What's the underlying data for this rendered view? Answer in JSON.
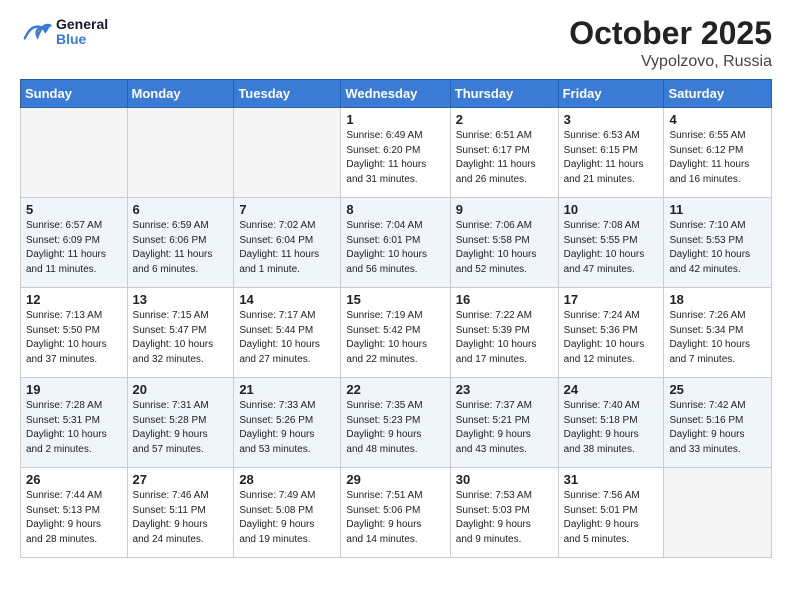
{
  "header": {
    "logo_line1": "General",
    "logo_line2": "Blue",
    "month": "October 2025",
    "location": "Vypolzovo, Russia"
  },
  "weekdays": [
    "Sunday",
    "Monday",
    "Tuesday",
    "Wednesday",
    "Thursday",
    "Friday",
    "Saturday"
  ],
  "weeks": [
    [
      {
        "day": "",
        "info": ""
      },
      {
        "day": "",
        "info": ""
      },
      {
        "day": "",
        "info": ""
      },
      {
        "day": "1",
        "info": "Sunrise: 6:49 AM\nSunset: 6:20 PM\nDaylight: 11 hours\nand 31 minutes."
      },
      {
        "day": "2",
        "info": "Sunrise: 6:51 AM\nSunset: 6:17 PM\nDaylight: 11 hours\nand 26 minutes."
      },
      {
        "day": "3",
        "info": "Sunrise: 6:53 AM\nSunset: 6:15 PM\nDaylight: 11 hours\nand 21 minutes."
      },
      {
        "day": "4",
        "info": "Sunrise: 6:55 AM\nSunset: 6:12 PM\nDaylight: 11 hours\nand 16 minutes."
      }
    ],
    [
      {
        "day": "5",
        "info": "Sunrise: 6:57 AM\nSunset: 6:09 PM\nDaylight: 11 hours\nand 11 minutes."
      },
      {
        "day": "6",
        "info": "Sunrise: 6:59 AM\nSunset: 6:06 PM\nDaylight: 11 hours\nand 6 minutes."
      },
      {
        "day": "7",
        "info": "Sunrise: 7:02 AM\nSunset: 6:04 PM\nDaylight: 11 hours\nand 1 minute."
      },
      {
        "day": "8",
        "info": "Sunrise: 7:04 AM\nSunset: 6:01 PM\nDaylight: 10 hours\nand 56 minutes."
      },
      {
        "day": "9",
        "info": "Sunrise: 7:06 AM\nSunset: 5:58 PM\nDaylight: 10 hours\nand 52 minutes."
      },
      {
        "day": "10",
        "info": "Sunrise: 7:08 AM\nSunset: 5:55 PM\nDaylight: 10 hours\nand 47 minutes."
      },
      {
        "day": "11",
        "info": "Sunrise: 7:10 AM\nSunset: 5:53 PM\nDaylight: 10 hours\nand 42 minutes."
      }
    ],
    [
      {
        "day": "12",
        "info": "Sunrise: 7:13 AM\nSunset: 5:50 PM\nDaylight: 10 hours\nand 37 minutes."
      },
      {
        "day": "13",
        "info": "Sunrise: 7:15 AM\nSunset: 5:47 PM\nDaylight: 10 hours\nand 32 minutes."
      },
      {
        "day": "14",
        "info": "Sunrise: 7:17 AM\nSunset: 5:44 PM\nDaylight: 10 hours\nand 27 minutes."
      },
      {
        "day": "15",
        "info": "Sunrise: 7:19 AM\nSunset: 5:42 PM\nDaylight: 10 hours\nand 22 minutes."
      },
      {
        "day": "16",
        "info": "Sunrise: 7:22 AM\nSunset: 5:39 PM\nDaylight: 10 hours\nand 17 minutes."
      },
      {
        "day": "17",
        "info": "Sunrise: 7:24 AM\nSunset: 5:36 PM\nDaylight: 10 hours\nand 12 minutes."
      },
      {
        "day": "18",
        "info": "Sunrise: 7:26 AM\nSunset: 5:34 PM\nDaylight: 10 hours\nand 7 minutes."
      }
    ],
    [
      {
        "day": "19",
        "info": "Sunrise: 7:28 AM\nSunset: 5:31 PM\nDaylight: 10 hours\nand 2 minutes."
      },
      {
        "day": "20",
        "info": "Sunrise: 7:31 AM\nSunset: 5:28 PM\nDaylight: 9 hours\nand 57 minutes."
      },
      {
        "day": "21",
        "info": "Sunrise: 7:33 AM\nSunset: 5:26 PM\nDaylight: 9 hours\nand 53 minutes."
      },
      {
        "day": "22",
        "info": "Sunrise: 7:35 AM\nSunset: 5:23 PM\nDaylight: 9 hours\nand 48 minutes."
      },
      {
        "day": "23",
        "info": "Sunrise: 7:37 AM\nSunset: 5:21 PM\nDaylight: 9 hours\nand 43 minutes."
      },
      {
        "day": "24",
        "info": "Sunrise: 7:40 AM\nSunset: 5:18 PM\nDaylight: 9 hours\nand 38 minutes."
      },
      {
        "day": "25",
        "info": "Sunrise: 7:42 AM\nSunset: 5:16 PM\nDaylight: 9 hours\nand 33 minutes."
      }
    ],
    [
      {
        "day": "26",
        "info": "Sunrise: 7:44 AM\nSunset: 5:13 PM\nDaylight: 9 hours\nand 28 minutes."
      },
      {
        "day": "27",
        "info": "Sunrise: 7:46 AM\nSunset: 5:11 PM\nDaylight: 9 hours\nand 24 minutes."
      },
      {
        "day": "28",
        "info": "Sunrise: 7:49 AM\nSunset: 5:08 PM\nDaylight: 9 hours\nand 19 minutes."
      },
      {
        "day": "29",
        "info": "Sunrise: 7:51 AM\nSunset: 5:06 PM\nDaylight: 9 hours\nand 14 minutes."
      },
      {
        "day": "30",
        "info": "Sunrise: 7:53 AM\nSunset: 5:03 PM\nDaylight: 9 hours\nand 9 minutes."
      },
      {
        "day": "31",
        "info": "Sunrise: 7:56 AM\nSunset: 5:01 PM\nDaylight: 9 hours\nand 5 minutes."
      },
      {
        "day": "",
        "info": ""
      }
    ]
  ]
}
